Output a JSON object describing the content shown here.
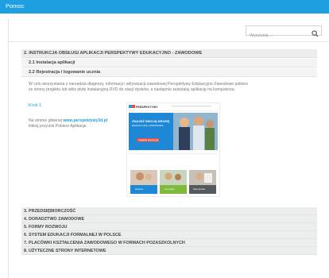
{
  "app": {
    "title": "Pomoc"
  },
  "search": {
    "placeholder": "Wyszukaj ...",
    "value": ""
  },
  "section2": {
    "title": "2. INSTRUKCJA OBSŁUGI APLIKACJI PERSPEKTYWY EDUKACYJNO - ZAWODOWE",
    "sub1": "2.1 Instalacja aplikacji",
    "sub2": "2.2 Rejestracja i logowanie ucznia",
    "para1": "W celu skorzystania z narzędzia diagnozy, informacji i aktywizacji zawodowej Perspektywy Edukacyjno-Zawodowe pobierz",
    "para2": "ze strony projektu lub włóż płytę instalacyjną DVD do stacji dysków, a następnie zainstaluj aplikację na komputerze.",
    "krok": "Krok 1",
    "note_prefix": "Na stronie głównej ",
    "note_link": "www.perspektywy3d.pl",
    "note_line2": "kliknij przycisk Pobierz Aplikacje."
  },
  "screenshot": {
    "logo": "PERSPEKTYWY",
    "banner_line1": "ZNAJDŹ SWOJĄ DROGĘ",
    "banner_line2": "EDUKACYJNĄ I ZAWODOWĄ",
    "banner_button": "POBIERZ APLIKACJĘ",
    "tile1_label": "Rodzice",
    "tile2_label": "Uczniowie",
    "tile3_label": "Nauczyciele"
  },
  "sections": [
    "3. PRZEDSIĘBIORCZOŚĆ",
    "4. DORADZTWO ZAWODOWE",
    "5. FORMY ROZWOJU",
    "6. SYSTEM EDUKACJI FORMALNEJ W POLSCE",
    "7. PLACÓWKI KSZTAŁCENIA ZAWODOWEGO W FORMACH POZASZKOLNYCH",
    "8. UŻYTECZNE STRONY INTERNETOWE"
  ],
  "colors": {
    "topbar": "#1e9fe0",
    "link": "#1e9fe0",
    "section_bg": "#eceded"
  }
}
